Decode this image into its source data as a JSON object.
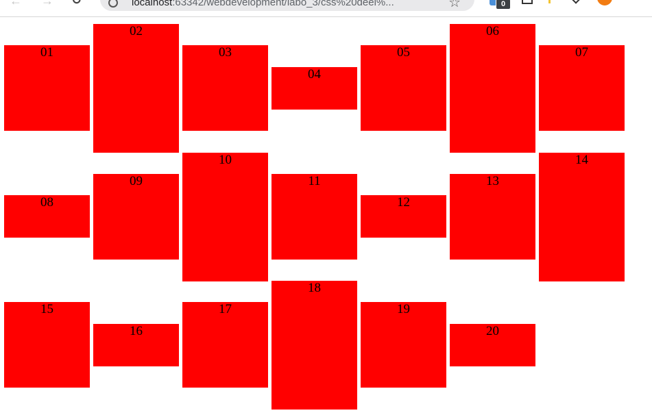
{
  "browser": {
    "url_host": "localhost",
    "url_rest": ":63342/webdevelopment/labo_3/css%20deel%...",
    "extension_badge": "0"
  },
  "boxes": [
    {
      "label": "01"
    },
    {
      "label": "02"
    },
    {
      "label": "03"
    },
    {
      "label": "04"
    },
    {
      "label": "05"
    },
    {
      "label": "06"
    },
    {
      "label": "07"
    },
    {
      "label": "08"
    },
    {
      "label": "09"
    },
    {
      "label": "10"
    },
    {
      "label": "11"
    },
    {
      "label": "12"
    },
    {
      "label": "13"
    },
    {
      "label": "14"
    },
    {
      "label": "15"
    },
    {
      "label": "16"
    },
    {
      "label": "17"
    },
    {
      "label": "18"
    },
    {
      "label": "19"
    },
    {
      "label": "20"
    }
  ],
  "colors": {
    "box": "#ff0000",
    "page_background": "#ffffff"
  }
}
